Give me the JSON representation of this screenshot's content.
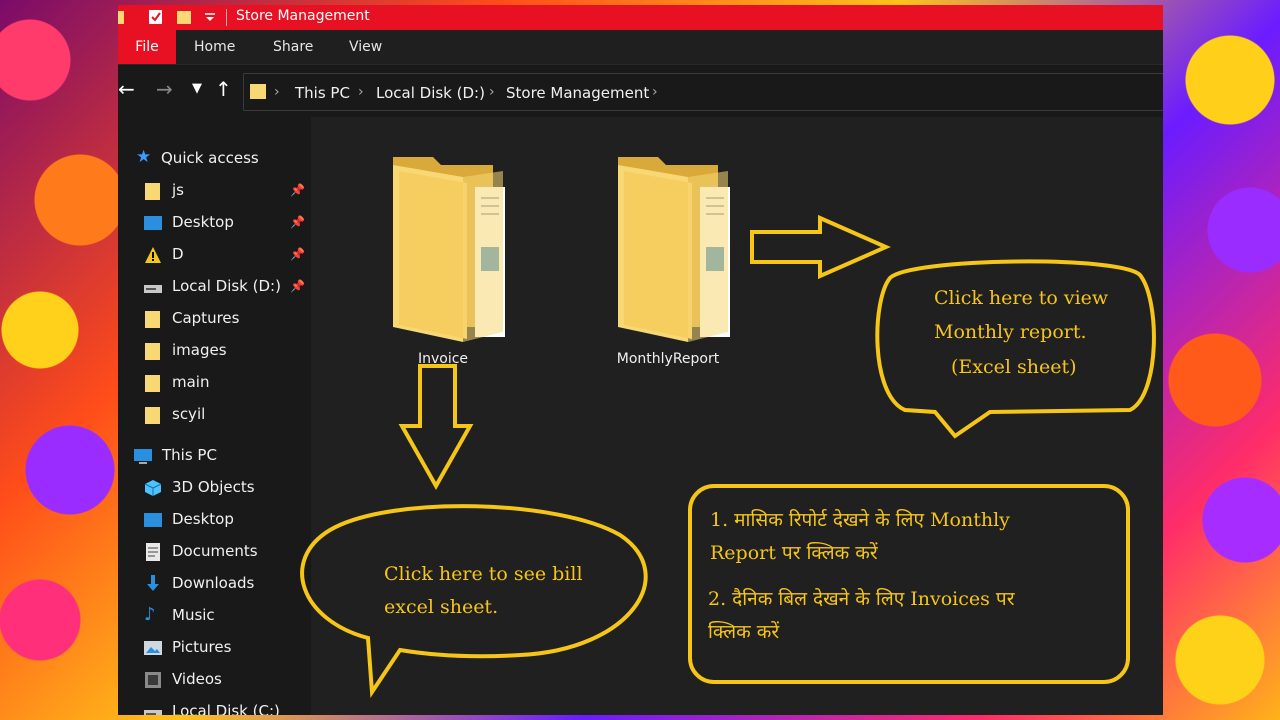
{
  "window": {
    "title": "Store Management"
  },
  "ribbon": {
    "tabs": [
      "File",
      "Home",
      "Share",
      "View"
    ]
  },
  "address": {
    "crumbs": [
      "This PC",
      "Local Disk (D:)",
      "Store Management"
    ]
  },
  "sidebar": {
    "quick_access": "Quick access",
    "quick_items": [
      "js",
      "Desktop",
      "D",
      "Local Disk (D:)",
      "Captures",
      "images",
      "main",
      "scyil"
    ],
    "this_pc": "This PC",
    "pc_items": [
      "3D Objects",
      "Desktop",
      "Documents",
      "Downloads",
      "Music",
      "Pictures",
      "Videos",
      "Local Disk (C:)"
    ]
  },
  "content": {
    "folders": [
      "Invoice",
      "MonthlyReport"
    ]
  },
  "annotations": {
    "bill_note_1": "Click here to see bill",
    "bill_note_2": "excel sheet.",
    "report_note_1": "Click here to view",
    "report_note_2": "Monthly report.",
    "report_note_3": "(Excel sheet)",
    "hindi_1a": "1. मासिक रिपोर्ट देखने के लिए Monthly",
    "hindi_1b": "Report  पर क्लिक करें",
    "hindi_2a": "2. दैनिक बिल देखने के लिए Invoices पर",
    "hindi_2b": "क्लिक करें"
  },
  "colors": {
    "accent": "#e81123",
    "annotation": "#f5c518",
    "folder": "#f8d775"
  }
}
